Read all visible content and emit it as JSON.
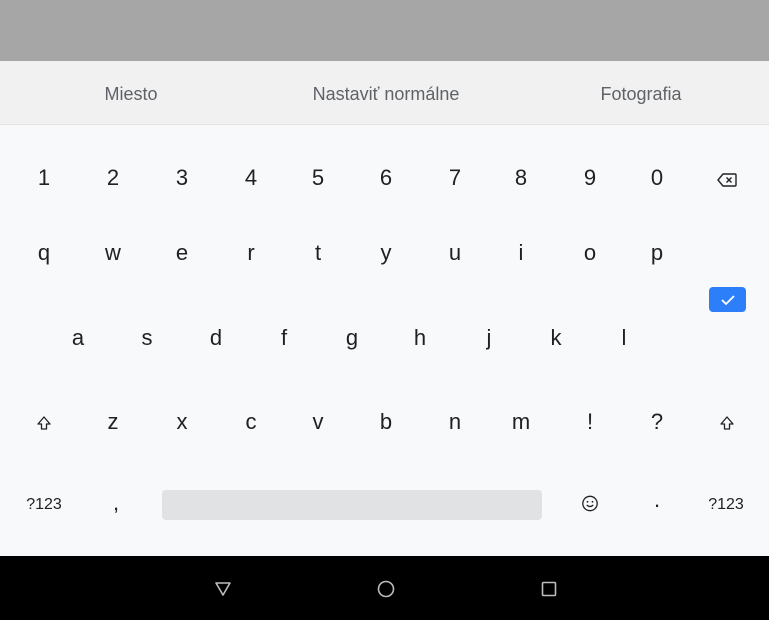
{
  "suggestions": [
    "Miesto",
    "Nastaviť normálne",
    "Fotografia"
  ],
  "keys": {
    "digits": [
      "1",
      "2",
      "3",
      "4",
      "5",
      "6",
      "7",
      "8",
      "9",
      "0"
    ],
    "row1": [
      "q",
      "w",
      "e",
      "r",
      "t",
      "y",
      "u",
      "i",
      "o",
      "p"
    ],
    "row2": [
      "a",
      "s",
      "d",
      "f",
      "g",
      "h",
      "j",
      "k",
      "l"
    ],
    "row3": [
      "z",
      "x",
      "c",
      "v",
      "b",
      "n",
      "m",
      "!",
      "?"
    ],
    "symbols_left": "?123",
    "comma": ",",
    "period": ".",
    "symbols_right": "?123"
  },
  "icons": {
    "backspace": "backspace-icon",
    "enter": "checkmark-icon",
    "shift": "shift-arrow-icon",
    "emoji": "emoji-icon",
    "nav": [
      "back-triangle-icon",
      "home-circle-icon",
      "recents-square-icon"
    ]
  },
  "colors": {
    "accent": "#2d7ff9",
    "status_bar": "#a6a6a6",
    "nav_bar": "#000000"
  }
}
